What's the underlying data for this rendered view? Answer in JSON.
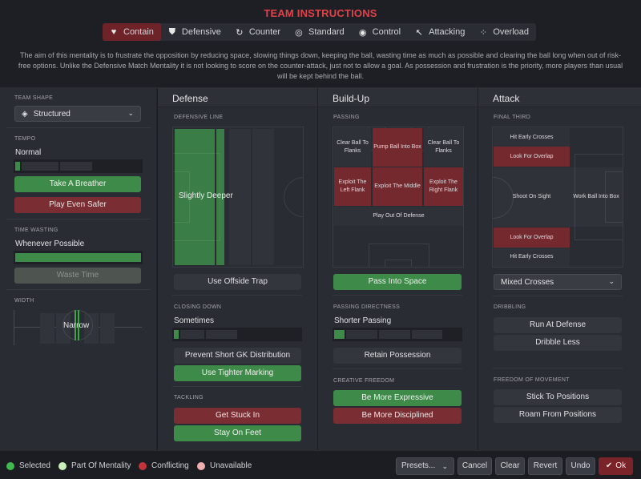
{
  "header": {
    "title": "TEAM INSTRUCTIONS",
    "mentalities": [
      {
        "label": "Contain",
        "icon": "heart-shield-icon",
        "active": true
      },
      {
        "label": "Defensive",
        "icon": "shield-icon",
        "active": false
      },
      {
        "label": "Counter",
        "icon": "counter-arrow-icon",
        "active": false
      },
      {
        "label": "Standard",
        "icon": "target-icon",
        "active": false
      },
      {
        "label": "Control",
        "icon": "control-icon",
        "active": false
      },
      {
        "label": "Attacking",
        "icon": "arrow-up-left-icon",
        "active": false
      },
      {
        "label": "Overload",
        "icon": "overload-icon",
        "active": false
      }
    ],
    "description": "The aim of this mentality is to frustrate the opposition by reducing space, slowing things down, keeping the ball, wasting time as much as possible and clearing the ball long when out of risk-free options. Unlike the Defensive Match Mentality it is not looking to score on the counter-attack, just not to allow a goal. As possession and frustration is the priority, more players than usual will be kept behind the ball."
  },
  "sidebar": {
    "team_shape": {
      "label": "TEAM SHAPE",
      "value": "Structured"
    },
    "tempo": {
      "label": "TEMPO",
      "value": "Normal",
      "level": 1,
      "levels": 3,
      "buttons": [
        {
          "label": "Take A Breather",
          "state": "selected"
        },
        {
          "label": "Play Even Safer",
          "state": "conflicting"
        }
      ]
    },
    "time_wasting": {
      "label": "TIME WASTING",
      "value": "Whenever Possible",
      "level_fraction": 1.0,
      "button": {
        "label": "Waste Time",
        "state": "unavailable"
      }
    },
    "width": {
      "label": "WIDTH",
      "value": "Narrow"
    }
  },
  "defense": {
    "title": "Defense",
    "defensive_line": {
      "label": "DEFENSIVE LINE",
      "value": "Slightly Deeper"
    },
    "offside_button": "Use Offside Trap",
    "closing_down": {
      "label": "CLOSING DOWN",
      "value": "Sometimes",
      "level": 1,
      "levels": 3
    },
    "buttons": [
      {
        "label": "Prevent Short GK Distribution",
        "state": "none"
      },
      {
        "label": "Use Tighter Marking",
        "state": "selected"
      }
    ],
    "tackling": {
      "label": "TACKLING",
      "buttons": [
        {
          "label": "Get Stuck In",
          "state": "conflicting"
        },
        {
          "label": "Stay On Feet",
          "state": "selected"
        }
      ]
    }
  },
  "buildup": {
    "title": "Build-Up",
    "passing": {
      "label": "PASSING",
      "cells": {
        "clear_left": "Clear Ball To Flanks",
        "pump": "Pump Ball Into Box",
        "clear_right": "Clear Ball To Flanks",
        "exploit_left": "Exploit The Left Flank",
        "exploit_middle": "Exploit The Middle",
        "exploit_right": "Exploit The Right Flank",
        "play_out": "Play Out Of Defense"
      }
    },
    "pass_into_space": "Pass Into Space",
    "directness": {
      "label": "PASSING DIRECTNESS",
      "value": "Shorter Passing",
      "level": 1,
      "levels": 4
    },
    "retain_possession": "Retain Possession",
    "creative_freedom": {
      "label": "CREATIVE FREEDOM",
      "buttons": [
        {
          "label": "Be More Expressive",
          "state": "selected"
        },
        {
          "label": "Be More Disciplined",
          "state": "conflicting"
        }
      ]
    }
  },
  "attack": {
    "title": "Attack",
    "final_third": {
      "label": "FINAL THIRD",
      "cells": {
        "early_top": "Hit Early Crosses",
        "overlap_top": "Look For Overlap",
        "shoot": "Shoot On Sight",
        "work_ball": "Work Ball Into Box",
        "overlap_bottom": "Look For Overlap",
        "early_bottom": "Hit Early Crosses"
      }
    },
    "crossing": "Mixed Crosses",
    "dribbling": {
      "label": "DRIBBLING",
      "buttons": [
        "Run At Defense",
        "Dribble Less"
      ]
    },
    "freedom": {
      "label": "FREEDOM OF MOVEMENT",
      "buttons": [
        "Stick To Positions",
        "Roam From Positions"
      ]
    }
  },
  "footer": {
    "legend": [
      {
        "label": "Selected",
        "color": "#3fb950"
      },
      {
        "label": "Part Of Mentality",
        "color": "#c8f0b8"
      },
      {
        "label": "Conflicting",
        "color": "#c0343a"
      },
      {
        "label": "Unavailable",
        "color": "#f0aeb0"
      }
    ],
    "buttons": {
      "presets": "Presets...",
      "cancel": "Cancel",
      "clear": "Clear",
      "revert": "Revert",
      "undo": "Undo",
      "ok": "Ok"
    }
  }
}
